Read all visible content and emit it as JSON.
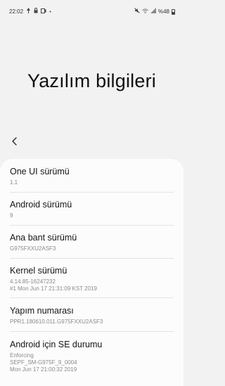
{
  "status_bar": {
    "time": "22:02",
    "battery": "%48"
  },
  "page": {
    "title": "Yazılım bilgileri"
  },
  "items": [
    {
      "title": "One UI sürümü",
      "lines": [
        "1.1"
      ]
    },
    {
      "title": "Android sürümü",
      "lines": [
        "9"
      ]
    },
    {
      "title": "Ana bant sürümü",
      "lines": [
        "G975FXXU2ASF3"
      ]
    },
    {
      "title": "Kernel sürümü",
      "lines": [
        "4.14.85-16247232",
        "#1 Mon Jun 17 21:31:09 KST 2019"
      ]
    },
    {
      "title": "Yapım numarası",
      "lines": [
        "PPR1.180610.011.G975FXXU2ASF3"
      ]
    },
    {
      "title": "Android için SE durumu",
      "lines": [
        "Enforcing",
        "SEPF_SM-G975F_9_0004",
        "Mon Jun 17 21:00:32 2019"
      ]
    }
  ]
}
